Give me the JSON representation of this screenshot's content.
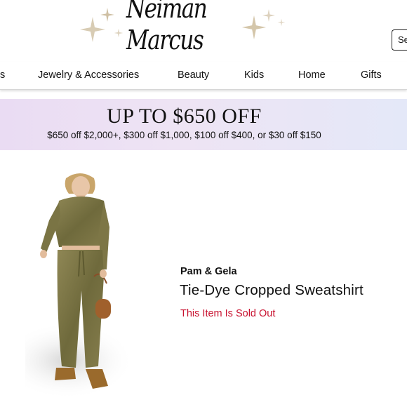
{
  "brand_logo": "Neiman Marcus",
  "search": {
    "visible_text": "Se"
  },
  "nav": {
    "items": [
      {
        "label": "s"
      },
      {
        "label": "Jewelry & Accessories"
      },
      {
        "label": "Beauty"
      },
      {
        "label": "Kids"
      },
      {
        "label": "Home"
      },
      {
        "label": "Gifts"
      }
    ]
  },
  "promo": {
    "title": "UP TO $650 OFF",
    "subtitle": "$650 off $2,000+, $300 off $1,000, $100 off $400, or $30 off $150"
  },
  "product": {
    "brand": "Pam & Gela",
    "name": "Tie-Dye Cropped Sweatshirt",
    "status": "This Item Is Sold Out",
    "image_icon": "model-photo-olive-tie-dye-set"
  },
  "colors": {
    "sold_out": "#c8102e",
    "promo_gradient_start": "#eadcf3",
    "promo_gradient_end": "#e4e8f8",
    "sparkle": "#c8b89a"
  }
}
